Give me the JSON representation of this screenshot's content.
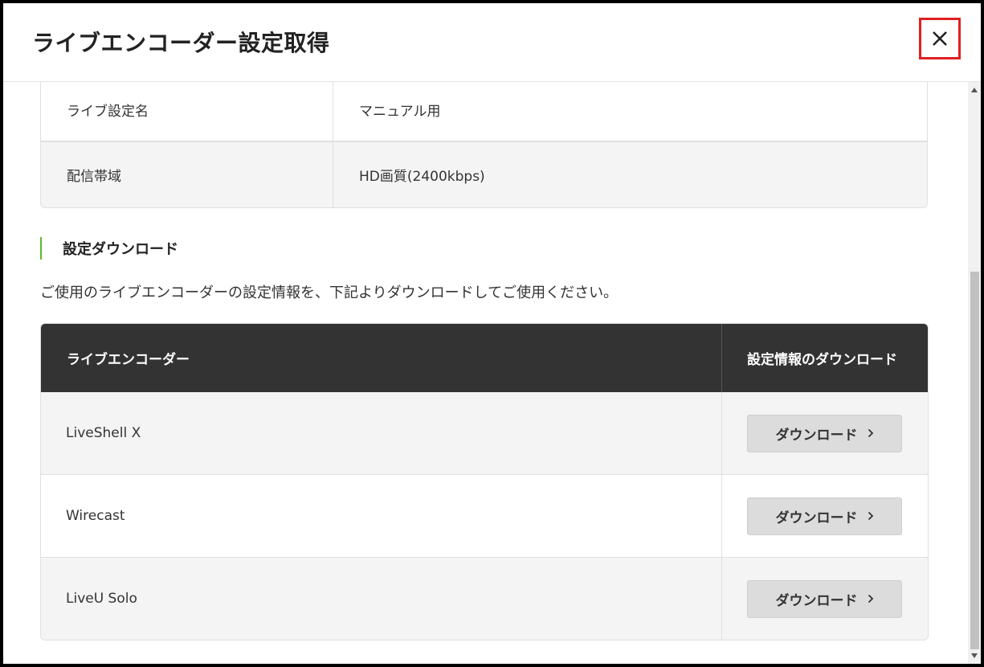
{
  "modal": {
    "title": "ライブエンコーダー設定取得",
    "close_icon": "close-icon"
  },
  "info_table": [
    {
      "label": "ライブ設定名",
      "value": "マニュアル用"
    },
    {
      "label": "配信帯域",
      "value": "HD画質(2400kbps)"
    }
  ],
  "section": {
    "heading": "設定ダウンロード",
    "description": "ご使用のライブエンコーダーの設定情報を、下記よりダウンロードしてご使用ください。",
    "accent_color": "#5cb82e"
  },
  "encoder_table": {
    "headers": [
      "ライブエンコーダー",
      "設定情報のダウンロード"
    ],
    "rows": [
      {
        "name": "LiveShell X",
        "button": "ダウンロード"
      },
      {
        "name": "Wirecast",
        "button": "ダウンロード"
      },
      {
        "name": "LiveU Solo",
        "button": "ダウンロード"
      }
    ],
    "button_icon": "chevron-right-icon"
  },
  "colors": {
    "header_bg": "#333333",
    "close_border": "#e02020",
    "button_bg": "#dcdcdc"
  }
}
